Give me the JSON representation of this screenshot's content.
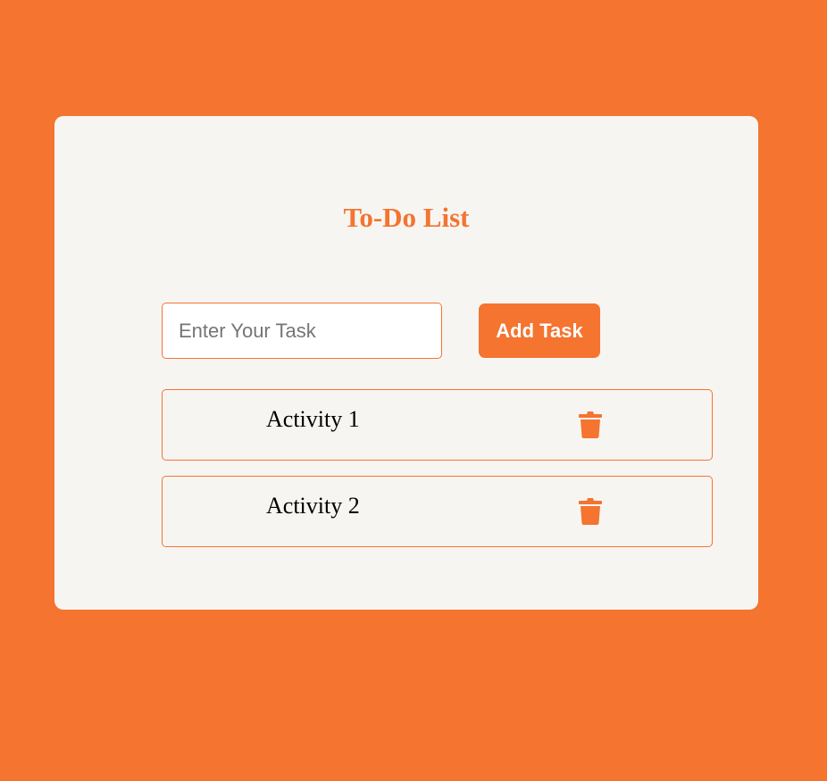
{
  "page": {
    "background_color": "#f47430",
    "card_color": "#f7f5f2",
    "accent_color": "#f47430"
  },
  "header": {
    "title": "To-Do List"
  },
  "task_input": {
    "placeholder": "Enter Your Task",
    "value": ""
  },
  "add_button": {
    "label": "Add Task"
  },
  "tasks": [
    {
      "label": "Activity 1",
      "icon": "trash-icon"
    },
    {
      "label": "Activity 2",
      "icon": "trash-icon"
    }
  ]
}
